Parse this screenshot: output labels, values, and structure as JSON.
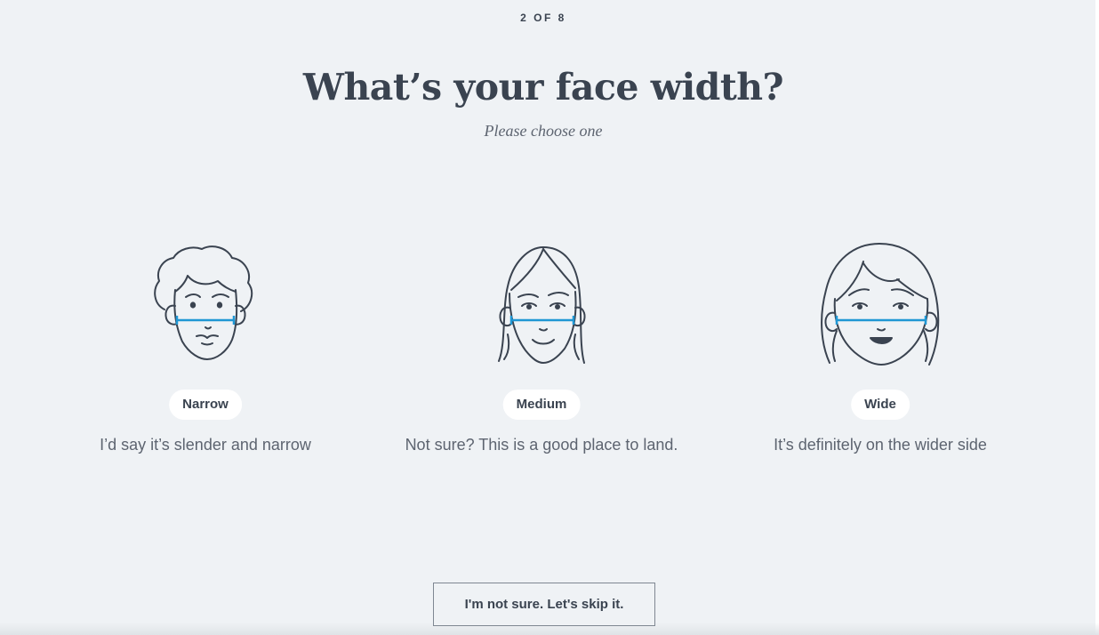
{
  "progress": {
    "label": "2 OF 8",
    "current": 2,
    "total": 8
  },
  "heading": "What’s your face width?",
  "subheading": "Please choose one",
  "options": [
    {
      "label": "Narrow",
      "description": "I’d say it’s slender and narrow",
      "icon": "narrow-face-icon"
    },
    {
      "label": "Medium",
      "description": "Not sure? This is a good place to land.",
      "icon": "medium-face-icon"
    },
    {
      "label": "Wide",
      "description": "It’s definitely on the wider side",
      "icon": "wide-face-icon"
    }
  ],
  "skip_button": "I'm not sure. Let's skip it.",
  "colors": {
    "background": "#eff2f5",
    "text": "#3a4350",
    "accent_measure_line": "#1f97d4",
    "pill_background": "#ffffff"
  }
}
